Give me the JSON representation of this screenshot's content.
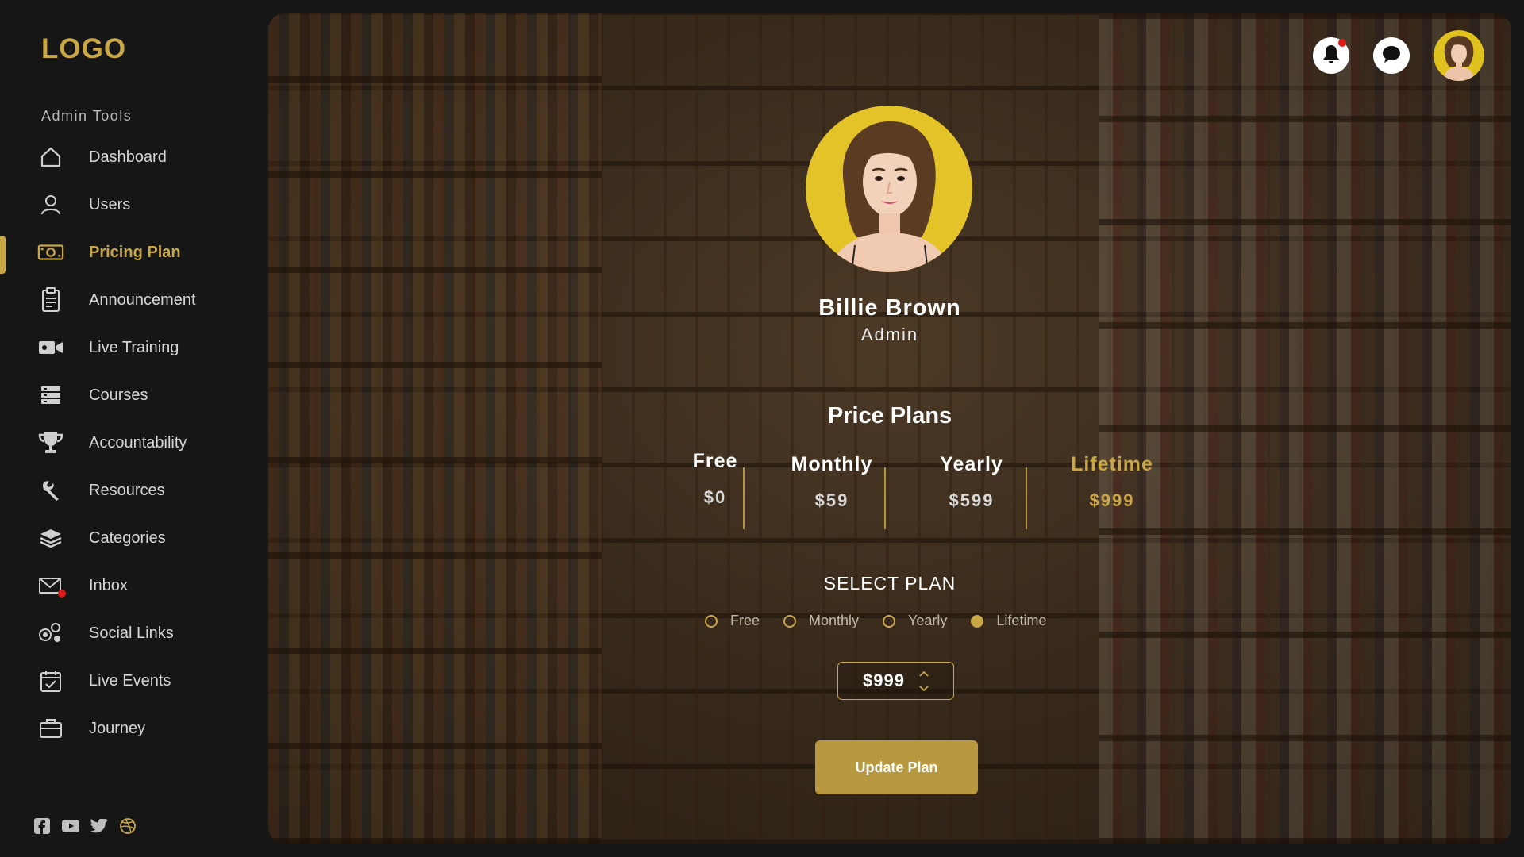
{
  "brand": {
    "logo": "LOGO",
    "accent": "#c9a646"
  },
  "sidebar": {
    "section_label": "Admin Tools",
    "items": [
      {
        "label": "Dashboard",
        "icon": "home-icon"
      },
      {
        "label": "Users",
        "icon": "user-icon"
      },
      {
        "label": "Pricing Plan",
        "icon": "money-icon",
        "active": true
      },
      {
        "label": "Announcement",
        "icon": "clipboard-icon"
      },
      {
        "label": "Live Training",
        "icon": "video-icon"
      },
      {
        "label": "Courses",
        "icon": "stack-icon"
      },
      {
        "label": "Accountability",
        "icon": "trophy-icon"
      },
      {
        "label": "Resources",
        "icon": "wrench-icon"
      },
      {
        "label": "Categories",
        "icon": "layers-icon"
      },
      {
        "label": "Inbox",
        "icon": "mail-icon",
        "has_notification": true
      },
      {
        "label": "Social Links",
        "icon": "social-icon"
      },
      {
        "label": "Live Events",
        "icon": "calendar-check-icon"
      },
      {
        "label": "Journey",
        "icon": "briefcase-icon"
      }
    ],
    "social": [
      "facebook-icon",
      "youtube-icon",
      "twitter-icon",
      "dribbble-icon"
    ]
  },
  "header": {
    "notification_icon": "bell-icon",
    "chat_icon": "chat-icon",
    "has_notification": true
  },
  "profile": {
    "name": "Billie Brown",
    "role": "Admin"
  },
  "plans": {
    "title": "Price Plans",
    "items": [
      {
        "name": "Free",
        "price": "$0"
      },
      {
        "name": "Monthly",
        "price": "$59"
      },
      {
        "name": "Yearly",
        "price": "$599"
      },
      {
        "name": "Lifetime",
        "price": "$999",
        "highlighted": true
      }
    ]
  },
  "select_plan": {
    "title": "SELECT PLAN",
    "options": [
      "Free",
      "Monthly",
      "Yearly",
      "Lifetime"
    ],
    "selected": "Lifetime"
  },
  "amount": {
    "value": "$999"
  },
  "update_button": {
    "label": "Update Plan"
  }
}
